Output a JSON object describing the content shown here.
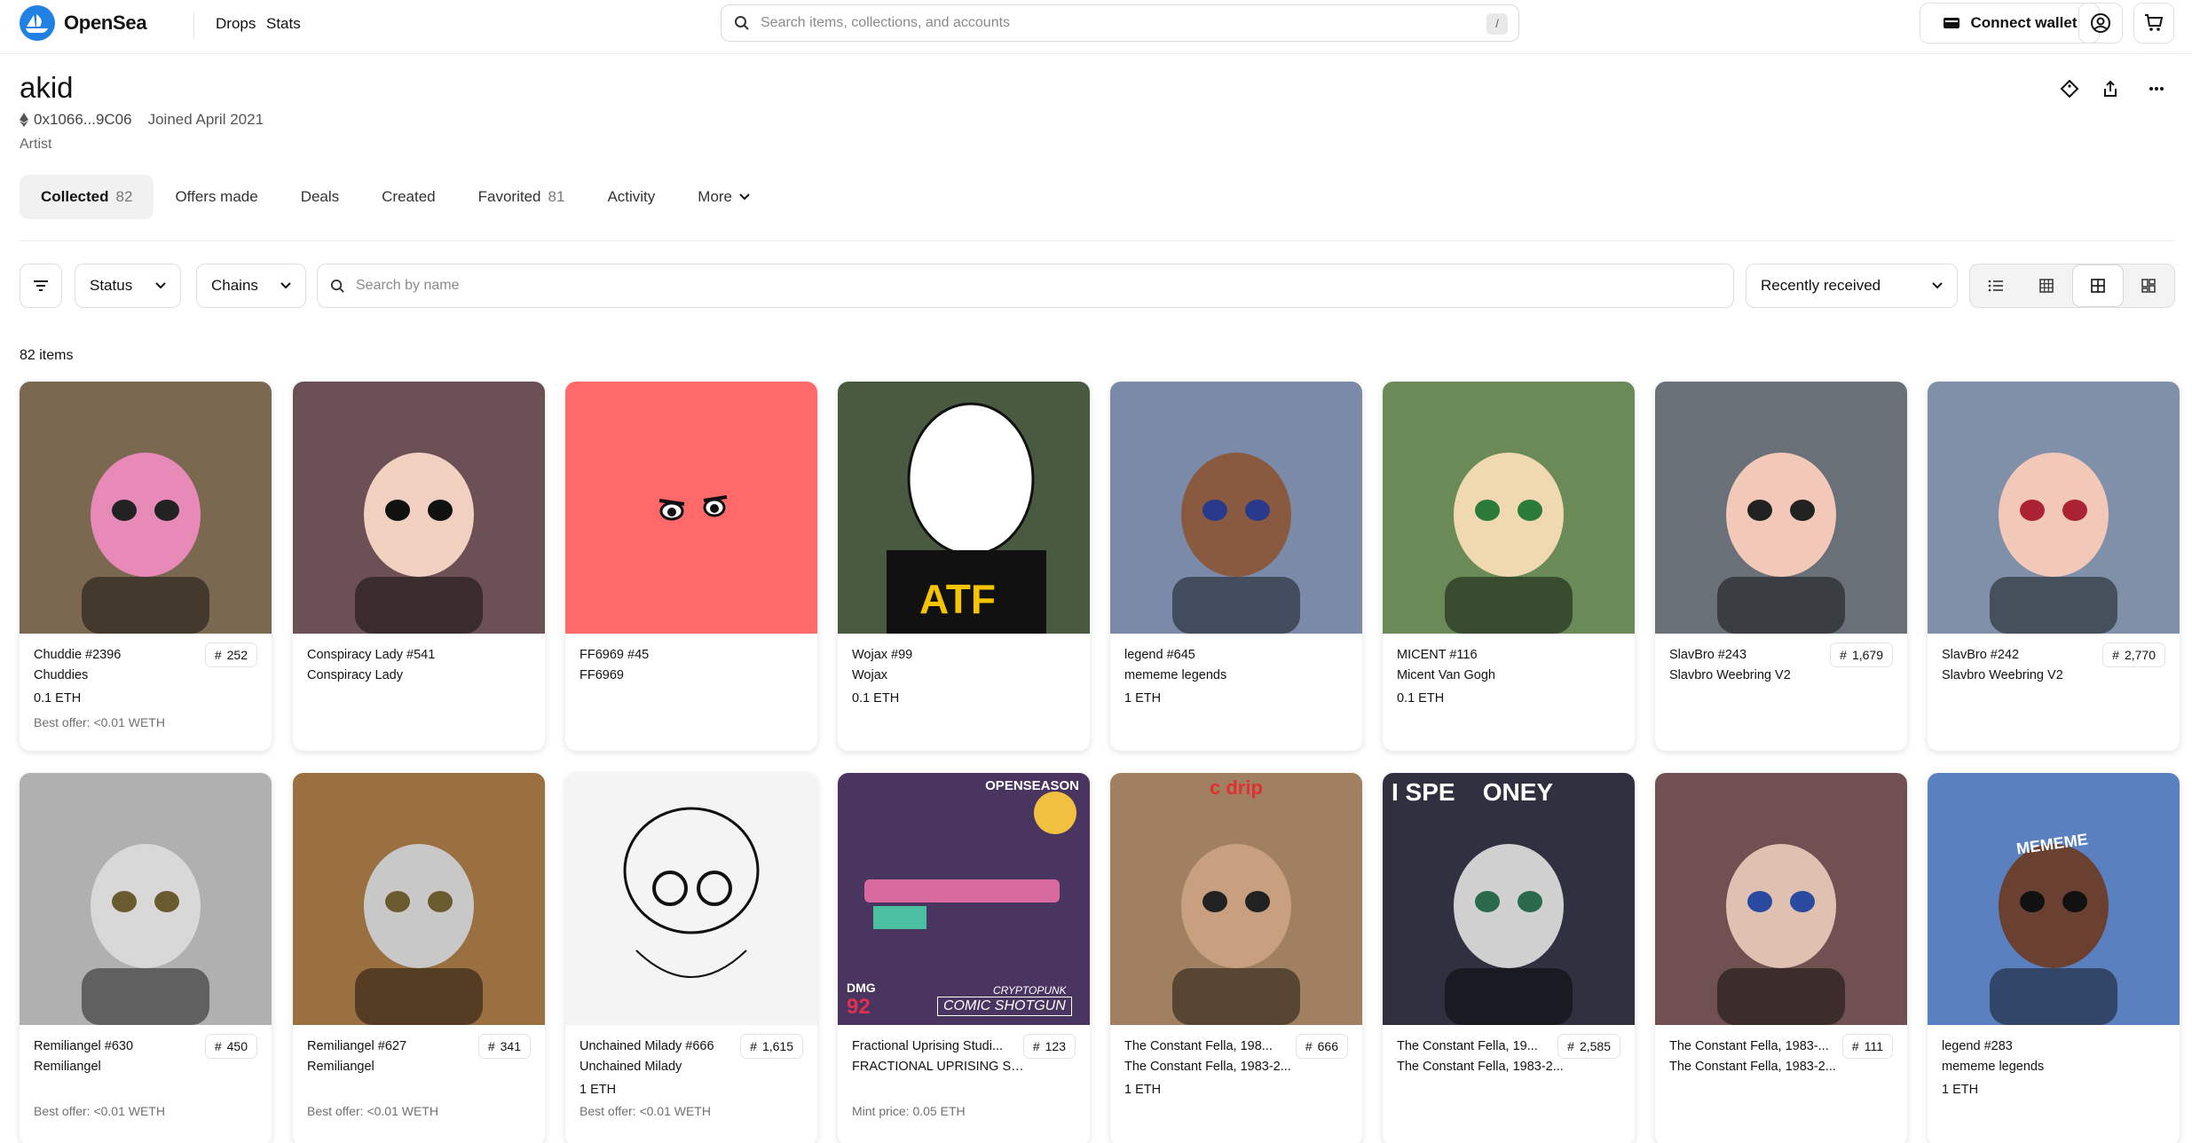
{
  "app": {
    "brand": "OpenSea",
    "nav": [
      "Drops",
      "Stats"
    ],
    "search_placeholder": "Search items, collections, and accounts",
    "search_shortcut": "/",
    "connect_wallet": "Connect wallet"
  },
  "profile": {
    "name": "akid",
    "address": "0x1066...9C06",
    "joined": "Joined April 2021",
    "role": "Artist"
  },
  "tabs": [
    {
      "label": "Collected",
      "count": "82"
    },
    {
      "label": "Offers made",
      "count": ""
    },
    {
      "label": "Deals",
      "count": ""
    },
    {
      "label": "Created",
      "count": ""
    },
    {
      "label": "Favorited",
      "count": "81"
    },
    {
      "label": "Activity",
      "count": ""
    },
    {
      "label": "More",
      "count": ""
    }
  ],
  "filters": {
    "status": "Status",
    "chains": "Chains",
    "name_search_placeholder": "Search by name",
    "sort": "Recently received"
  },
  "items_count": "82 items",
  "cards": [
    {
      "title": "Chuddie #2396",
      "collection": "Chuddies",
      "price": "0.1 ETH",
      "offer": "Best offer: <0.01 WETH",
      "rank": "252",
      "bg": "#7a6850"
    },
    {
      "title": "Conspiracy Lady #541",
      "collection": "Conspiracy Lady",
      "price": "",
      "offer": "",
      "rank": "",
      "bg": "#6b5055"
    },
    {
      "title": "FF6969 #45",
      "collection": "FF6969",
      "price": "",
      "offer": "",
      "rank": "",
      "bg": "#ff6969"
    },
    {
      "title": "Wojax #99",
      "collection": "Wojax",
      "price": "0.1 ETH",
      "offer": "",
      "rank": "",
      "bg": "#4a5a40"
    },
    {
      "title": "legend #645",
      "collection": "mememe legends",
      "price": "1 ETH",
      "offer": "",
      "rank": "",
      "bg": "#7a8aa8"
    },
    {
      "title": "MICENT #116",
      "collection": "Micent Van Gogh",
      "price": "0.1 ETH",
      "offer": "",
      "rank": "",
      "bg": "#6a8a58"
    },
    {
      "title": "SlavBro #243",
      "collection": "Slavbro Weebring V2",
      "price": "",
      "offer": "",
      "rank": "1,679",
      "bg": "#6a7078"
    },
    {
      "title": "SlavBro #242",
      "collection": "Slavbro Weebring V2",
      "price": "",
      "offer": "",
      "rank": "2,770",
      "bg": "#8090a8"
    },
    {
      "title": "Remiliangel #630",
      "collection": "Remiliangel",
      "price": "",
      "offer": "Best offer: <0.01 WETH",
      "rank": "450",
      "bg": "#b0b0b0"
    },
    {
      "title": "Remiliangel #627",
      "collection": "Remiliangel",
      "price": "",
      "offer": "Best offer: <0.01 WETH",
      "rank": "341",
      "bg": "#9a7040"
    },
    {
      "title": "Unchained Milady #666",
      "collection": "Unchained Milady",
      "price": "1 ETH",
      "offer": "Best offer: <0.01 WETH",
      "rank": "1,615",
      "bg": "#f4f4f4"
    },
    {
      "title": "Fractional Uprising Studi...",
      "collection": "FRACTIONAL UPRISING ST...",
      "price": "",
      "offer": "Mint price: 0.05 ETH",
      "rank": "123",
      "bg": "#4a3560"
    },
    {
      "title": "The Constant Fella, 198...",
      "collection": "The Constant Fella, 1983-2...",
      "price": "1 ETH",
      "offer": "",
      "rank": "666",
      "bg": "#a08060"
    },
    {
      "title": "The Constant Fella, 19...",
      "collection": "The Constant Fella, 1983-2...",
      "price": "",
      "offer": "",
      "rank": "2,585",
      "bg": "#303040"
    },
    {
      "title": "The Constant Fella, 1983-...",
      "collection": "The Constant Fella, 1983-2...",
      "price": "",
      "offer": "",
      "rank": "111",
      "bg": "#705050"
    },
    {
      "title": "legend #283",
      "collection": "mememe legends",
      "price": "1 ETH",
      "offer": "",
      "rank": "",
      "bg": "#5a80c0"
    }
  ],
  "card_image_text": {
    "atf": "ATF",
    "cdrip": "c drip",
    "opensea_season": "OPENSEASON",
    "shotgun": "COMIC SHOTGUN",
    "cryptopunk": "CRYPTOPUNK",
    "dmg": "DMG",
    "dmg_val": "92",
    "mememe": "MEMEME",
    "money": "I SPE    ONEY"
  }
}
